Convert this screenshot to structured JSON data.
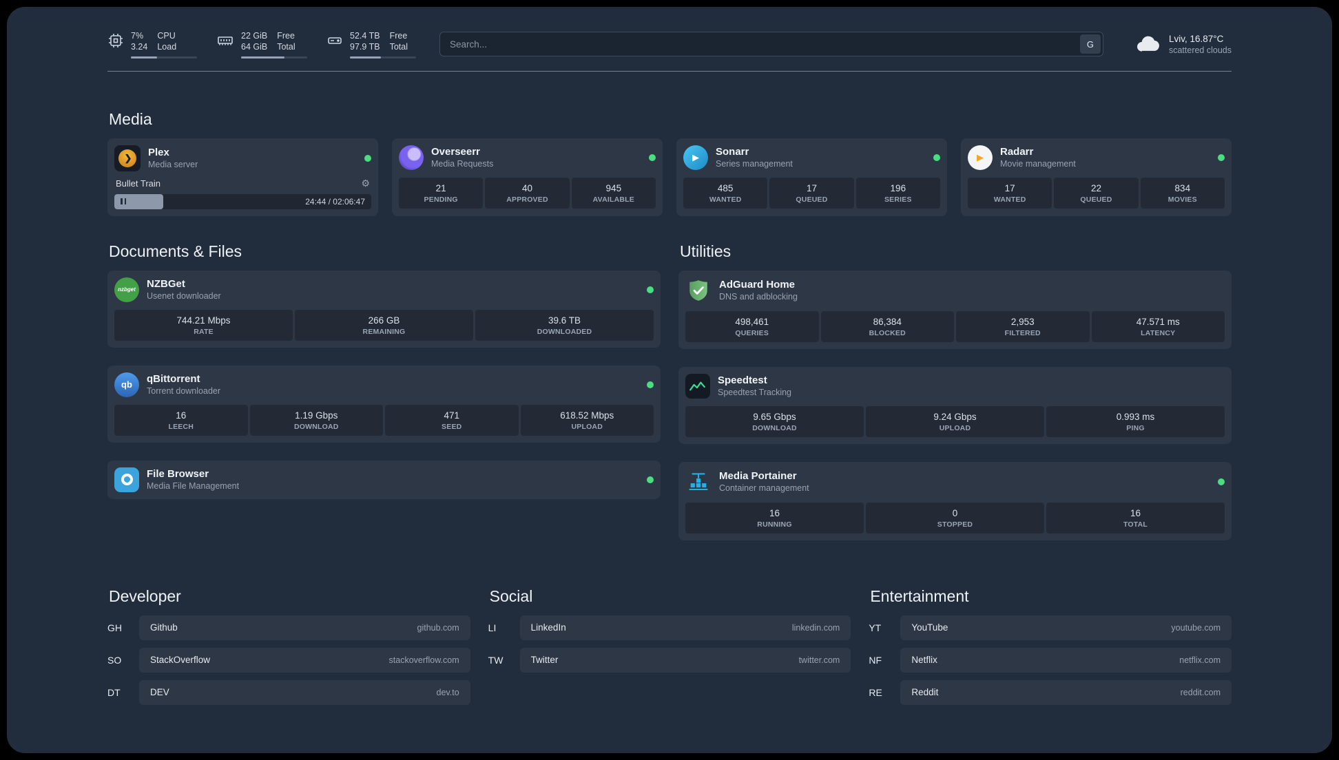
{
  "colors": {
    "status_online": "#4ade80",
    "plex": "#e5a00d",
    "overseerr": "#7a62f0",
    "sonarr": "#35c5f4",
    "radarr": "#f5a623",
    "nzbget": "#43a047",
    "qbittorrent": "#3a77c2",
    "filebrowser": "#3ca3dc",
    "adguard": "#68bc71",
    "speedtest": "#3ddc97",
    "portainer": "#22b1e7"
  },
  "topbar": {
    "cpu": {
      "value_top": "7%",
      "value_bottom": "3.24",
      "label_top": "CPU",
      "label_bottom": "Load",
      "bar_percent": 40
    },
    "memory": {
      "value_top": "22 GiB",
      "value_bottom": "64 GiB",
      "label_top": "Free",
      "label_bottom": "Total",
      "bar_percent": 66
    },
    "disk": {
      "value_top": "52.4 TB",
      "value_bottom": "97.9 TB",
      "label_top": "Free",
      "label_bottom": "Total",
      "bar_percent": 47
    },
    "search": {
      "placeholder": "Search...",
      "button_label": "G"
    },
    "weather": {
      "location": "Lviv, 16.87°C",
      "condition": "scattered clouds"
    }
  },
  "sections": {
    "media": {
      "title": "Media",
      "plex": {
        "name": "Plex",
        "subtitle": "Media server",
        "now_playing": "Bullet Train",
        "time": "24:44 / 02:06:47",
        "progress_percent": 19
      },
      "overseerr": {
        "name": "Overseerr",
        "subtitle": "Media Requests",
        "stats": [
          {
            "value": "21",
            "label": "PENDING"
          },
          {
            "value": "40",
            "label": "APPROVED"
          },
          {
            "value": "945",
            "label": "AVAILABLE"
          }
        ]
      },
      "sonarr": {
        "name": "Sonarr",
        "subtitle": "Series management",
        "stats": [
          {
            "value": "485",
            "label": "WANTED"
          },
          {
            "value": "17",
            "label": "QUEUED"
          },
          {
            "value": "196",
            "label": "SERIES"
          }
        ]
      },
      "radarr": {
        "name": "Radarr",
        "subtitle": "Movie management",
        "stats": [
          {
            "value": "17",
            "label": "WANTED"
          },
          {
            "value": "22",
            "label": "QUEUED"
          },
          {
            "value": "834",
            "label": "MOVIES"
          }
        ]
      }
    },
    "documents": {
      "title": "Documents & Files",
      "nzbget": {
        "name": "NZBGet",
        "subtitle": "Usenet downloader",
        "stats": [
          {
            "value": "744.21 Mbps",
            "label": "RATE"
          },
          {
            "value": "266 GB",
            "label": "REMAINING"
          },
          {
            "value": "39.6 TB",
            "label": "DOWNLOADED"
          }
        ]
      },
      "qbittorrent": {
        "name": "qBittorrent",
        "subtitle": "Torrent downloader",
        "stats": [
          {
            "value": "16",
            "label": "LEECH"
          },
          {
            "value": "1.19 Gbps",
            "label": "DOWNLOAD"
          },
          {
            "value": "471",
            "label": "SEED"
          },
          {
            "value": "618.52 Mbps",
            "label": "UPLOAD"
          }
        ]
      },
      "filebrowser": {
        "name": "File Browser",
        "subtitle": "Media File Management"
      }
    },
    "utilities": {
      "title": "Utilities",
      "adguard": {
        "name": "AdGuard Home",
        "subtitle": "DNS and adblocking",
        "stats": [
          {
            "value": "498,461",
            "label": "QUERIES"
          },
          {
            "value": "86,384",
            "label": "BLOCKED"
          },
          {
            "value": "2,953",
            "label": "FILTERED"
          },
          {
            "value": "47.571 ms",
            "label": "LATENCY"
          }
        ]
      },
      "speedtest": {
        "name": "Speedtest",
        "subtitle": "Speedtest Tracking",
        "stats": [
          {
            "value": "9.65 Gbps",
            "label": "DOWNLOAD"
          },
          {
            "value": "9.24 Gbps",
            "label": "UPLOAD"
          },
          {
            "value": "0.993 ms",
            "label": "PING"
          }
        ]
      },
      "portainer": {
        "name": "Media Portainer",
        "subtitle": "Container management",
        "stats": [
          {
            "value": "16",
            "label": "RUNNING"
          },
          {
            "value": "0",
            "label": "STOPPED"
          },
          {
            "value": "16",
            "label": "TOTAL"
          }
        ]
      }
    }
  },
  "bookmarks": {
    "developer": {
      "title": "Developer",
      "items": [
        {
          "abbr": "GH",
          "name": "Github",
          "url": "github.com"
        },
        {
          "abbr": "SO",
          "name": "StackOverflow",
          "url": "stackoverflow.com"
        },
        {
          "abbr": "DT",
          "name": "DEV",
          "url": "dev.to"
        }
      ]
    },
    "social": {
      "title": "Social",
      "items": [
        {
          "abbr": "LI",
          "name": "LinkedIn",
          "url": "linkedin.com"
        },
        {
          "abbr": "TW",
          "name": "Twitter",
          "url": "twitter.com"
        }
      ]
    },
    "entertainment": {
      "title": "Entertainment",
      "items": [
        {
          "abbr": "YT",
          "name": "YouTube",
          "url": "youtube.com"
        },
        {
          "abbr": "NF",
          "name": "Netflix",
          "url": "netflix.com"
        },
        {
          "abbr": "RE",
          "name": "Reddit",
          "url": "reddit.com"
        }
      ]
    }
  }
}
